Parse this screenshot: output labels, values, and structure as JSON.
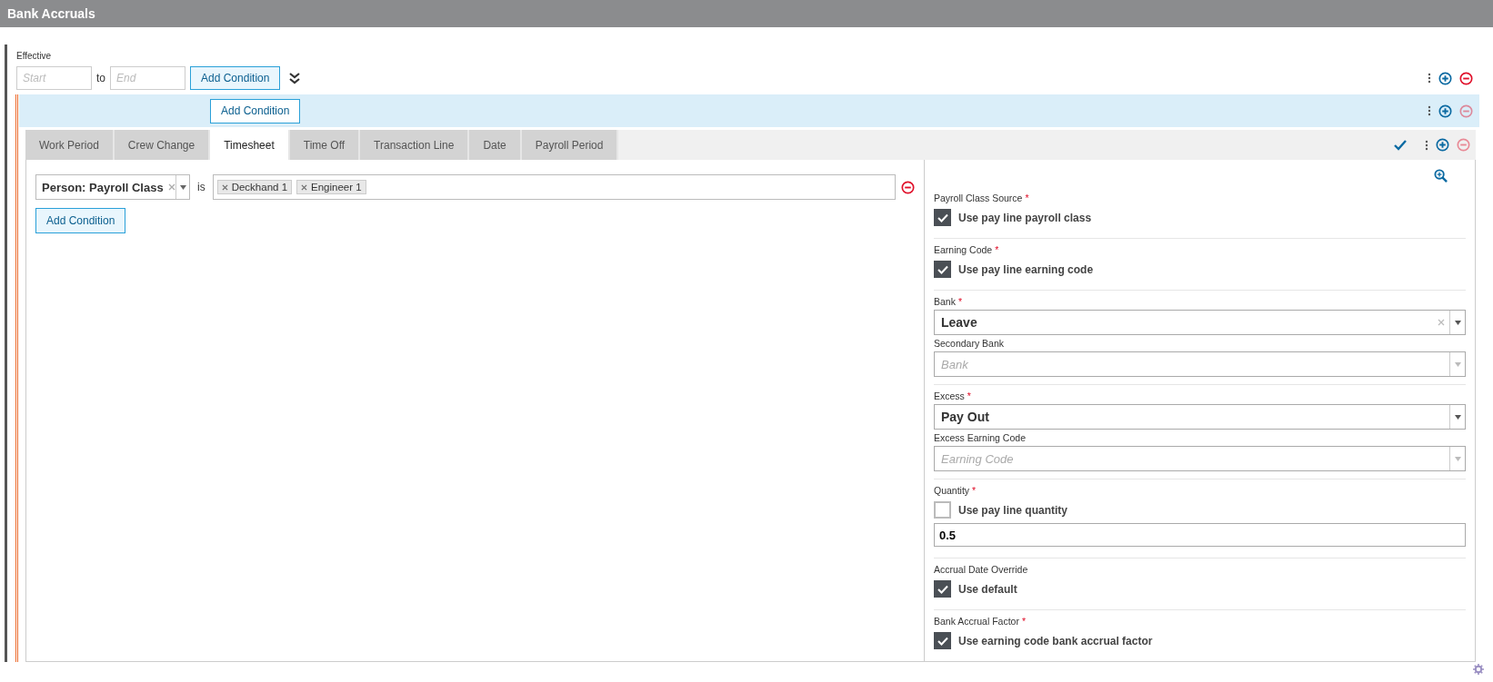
{
  "header": {
    "title": "Bank Accruals"
  },
  "effective": {
    "label": "Effective",
    "start_placeholder": "Start",
    "separator": "to",
    "end_placeholder": "End",
    "add_button": "Add Condition",
    "remove_disabled": false
  },
  "condition_band": {
    "add_button": "Add Condition",
    "remove_disabled": true
  },
  "tabs": [
    {
      "label": "Work Period",
      "selected": false
    },
    {
      "label": "Crew Change",
      "selected": false
    },
    {
      "label": "Timesheet",
      "selected": true
    },
    {
      "label": "Time Off",
      "selected": false
    },
    {
      "label": "Transaction Line",
      "selected": false
    },
    {
      "label": "Date",
      "selected": false
    },
    {
      "label": "Payroll Period",
      "selected": false
    }
  ],
  "tab_bar": {
    "saved": true,
    "remove_disabled": true
  },
  "conditions": [
    {
      "field": "Person: Payroll Class",
      "operator": "is",
      "values": [
        "Deckhand 1",
        "Engineer 1"
      ]
    }
  ],
  "conditions_add_button": "Add Condition",
  "settings": {
    "groups": [
      {
        "fields": [
          {
            "kind": "checkbox",
            "label": "Payroll Class Source",
            "required_mark": "*",
            "text": "Use pay line payroll class",
            "checked": true
          }
        ]
      },
      {
        "fields": [
          {
            "kind": "checkbox",
            "label": "Earning Code",
            "required_mark": "*",
            "text": "Use pay line earning code",
            "checked": true
          }
        ]
      },
      {
        "fields": [
          {
            "kind": "select",
            "label": "Bank",
            "required_mark": "*",
            "value": "Leave",
            "clearable": true,
            "disabled": false
          },
          {
            "kind": "select",
            "label": "Secondary Bank",
            "placeholder": "Bank",
            "clearable": false,
            "disabled": true
          }
        ]
      },
      {
        "fields": [
          {
            "kind": "select",
            "label": "Excess",
            "required_mark": "*",
            "value": "Pay Out",
            "clearable": false,
            "disabled": false
          },
          {
            "kind": "select",
            "label": "Excess Earning Code",
            "placeholder": "Earning Code",
            "clearable": false,
            "disabled": true
          }
        ]
      },
      {
        "fields": [
          {
            "kind": "checkbox",
            "label": "Quantity",
            "required_mark": "*",
            "text": "Use pay line quantity",
            "checked": false
          },
          {
            "kind": "input",
            "value": "0.5"
          }
        ]
      },
      {
        "fields": [
          {
            "kind": "checkbox",
            "label": "Accrual Date Override",
            "text": "Use default",
            "checked": true
          }
        ]
      },
      {
        "fields": [
          {
            "kind": "checkbox",
            "label": "Bank Accrual Factor",
            "required_mark": "*",
            "text": "Use earning code bank accrual factor",
            "checked": true
          }
        ]
      }
    ]
  }
}
